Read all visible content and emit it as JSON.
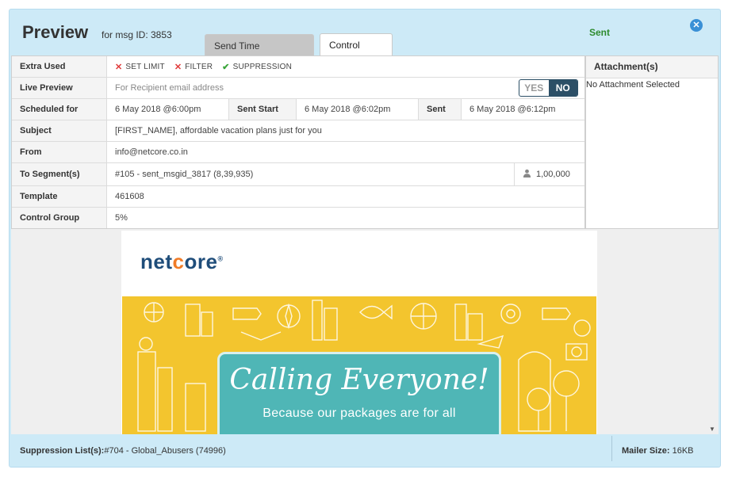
{
  "header": {
    "title": "Preview",
    "subtitle": "for msg ID: 3853",
    "tabs": [
      {
        "label": "Send Time Optimisation",
        "active": false
      },
      {
        "label": "Control Group",
        "active": true
      }
    ],
    "status": "Sent",
    "status_color": "#2e8b2e",
    "close_icon": "close-icon"
  },
  "details": {
    "extra_used": {
      "label": "Extra Used",
      "tags": [
        {
          "icon": "x-icon",
          "text": "SET LIMIT"
        },
        {
          "icon": "x-icon",
          "text": "FILTER"
        },
        {
          "icon": "check-icon",
          "text": "SUPPRESSION"
        }
      ]
    },
    "live_preview": {
      "label": "Live Preview",
      "placeholder": "For Recipient email address",
      "toggle_yes": "YES",
      "toggle_no": "NO",
      "selected": "NO"
    },
    "scheduled": {
      "label": "Scheduled for",
      "value": "6 May 2018 @6:00pm",
      "sent_start_label": "Sent Start",
      "sent_start_value": "6 May 2018 @6:02pm",
      "sent_label": "Sent",
      "sent_value": "6 May 2018 @6:12pm"
    },
    "subject": {
      "label": "Subject",
      "value": "[FIRST_NAME], affordable vacation plans just for you"
    },
    "from": {
      "label": "From",
      "value": "info@netcore.co.in"
    },
    "segment": {
      "label": "To Segment(s)",
      "value": "#105 - sent_msgid_3817 (8,39,935)",
      "count": "1,00,000",
      "count_icon": "user-icon"
    },
    "template": {
      "label": "Template",
      "value": "461608"
    },
    "control_group": {
      "label": "Control Group",
      "value": "5%"
    }
  },
  "attachments": {
    "header": "Attachment(s)",
    "value": "No Attachment Selected"
  },
  "email_preview": {
    "logo_text_a": "net",
    "logo_text_o": "c",
    "logo_text_b": "ore",
    "logo_mark": "®",
    "banner_heading": "Calling Everyone!",
    "banner_subheading": "Because our packages are for all",
    "brand_color": "#1f4d7a",
    "accent_color": "#f07c28",
    "banner_color": "#f3c52e",
    "card_color": "#4fb6b6"
  },
  "footer": {
    "suppression_label": "Suppression List(s):",
    "suppression_value": "#704 - Global_Abusers (74996)",
    "mailer_size_label": "Mailer Size:",
    "mailer_size_value": "16KB"
  }
}
